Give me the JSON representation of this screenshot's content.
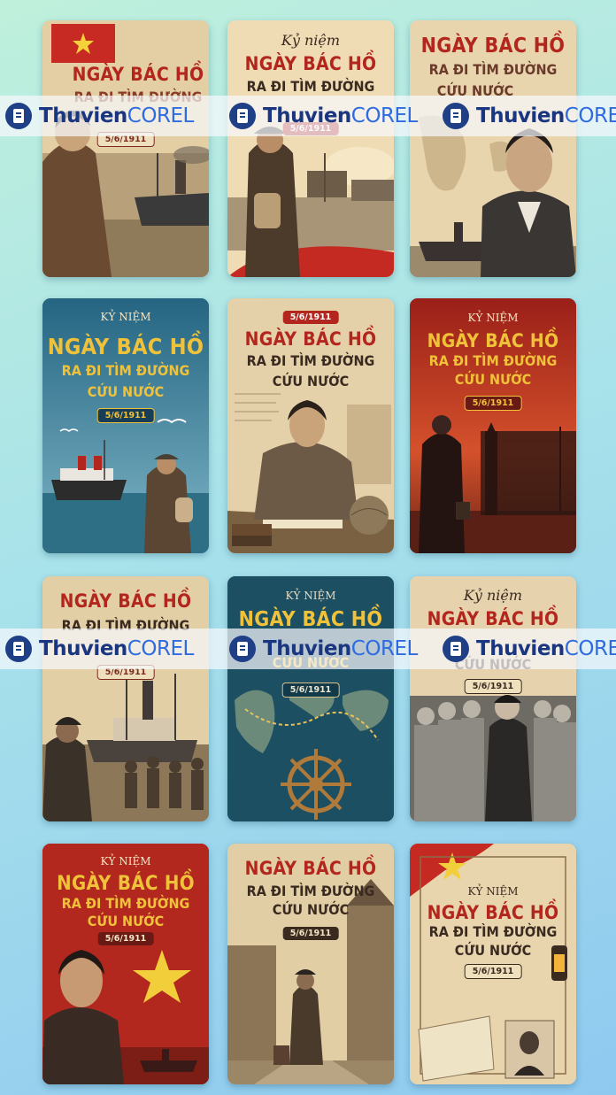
{
  "headline": "NGÀY BÁC HỒ",
  "subline1": "RA ĐI TÌM ĐƯỜNG",
  "subline2": "CỨU NƯỚC",
  "kyniem_caps": "KỶ NIỆM",
  "kyniem_italic": "Kỷ niệm",
  "date": "5/6/1911",
  "watermark": {
    "part1": "Thuvien",
    "part2": "COREL",
    "icon": "book-icon"
  },
  "colors": {
    "red": "#b3261e",
    "gold": "#f0c23a",
    "navy": "#1f3f86",
    "accent_blue": "#2f6be0"
  }
}
